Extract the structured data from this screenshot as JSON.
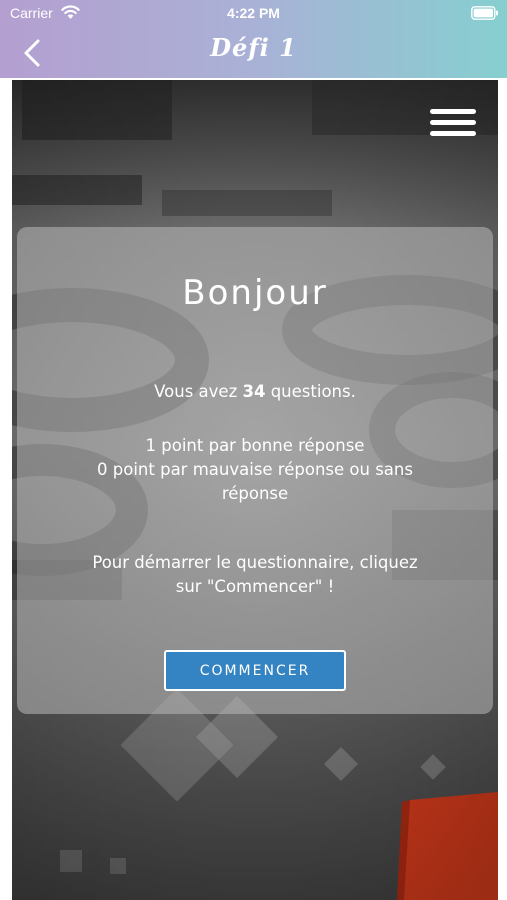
{
  "status_bar": {
    "carrier": "Carrier",
    "time": "4:22 PM"
  },
  "nav": {
    "title": "Défi 1"
  },
  "card": {
    "title": "Bonjour",
    "questions_prefix": "Vous avez ",
    "questions_count": "34",
    "questions_suffix": " questions.",
    "rule_good": "1 point par bonne réponse",
    "rule_bad_line1": "0 point par mauvaise réponse ou sans",
    "rule_bad_line2": "réponse",
    "instruction_line1": "Pour démarrer le questionnaire, cliquez",
    "instruction_line2": "sur \"Commencer\" !",
    "start_label": "COMMENCER"
  },
  "colors": {
    "header_start": "#b49fd0",
    "header_end": "#86cfd0",
    "button": "#3483c2",
    "cube": "#f2431f"
  }
}
